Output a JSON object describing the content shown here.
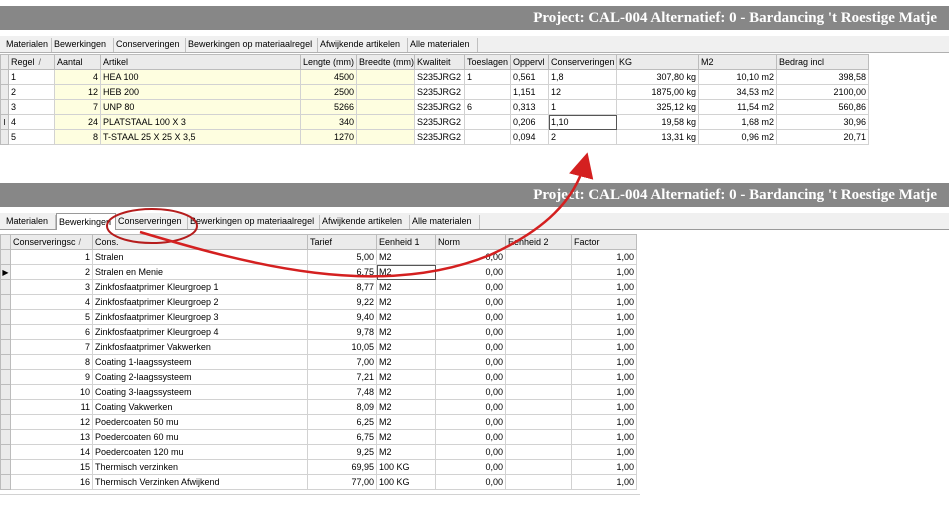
{
  "top": {
    "title": "Project: CAL-004 Alternatief: 0 - Bardancing 't Roestige Matje",
    "tabs": [
      "Materialen",
      "Bewerkingen",
      "Conserveringen",
      "Bewerkingen op materiaalregel",
      "Afwijkende artikelen",
      "Alle materialen"
    ],
    "active_tab": 0,
    "columns": [
      "Regel",
      "Aantal",
      "Artikel",
      "Lengte (mm)",
      "Breedte (mm)",
      "Kwaliteit",
      "Toeslagen",
      "Oppervl",
      "Conserveringen",
      "KG",
      "M2",
      "Bedrag incl"
    ],
    "sort_indicator": "/",
    "row_indicator_current": "I",
    "rows": [
      [
        "1",
        "4",
        "HEA  100",
        "4500",
        "",
        "S235JRG2",
        "1",
        "0,561",
        "1,8",
        "307,80 kg",
        "10,10 m2",
        "398,58"
      ],
      [
        "2",
        "12",
        "HEB  200",
        "2500",
        "",
        "S235JRG2",
        "",
        "1,151",
        "12",
        "1875,00 kg",
        "34,53 m2",
        "2100,00"
      ],
      [
        "3",
        "7",
        "UNP  80",
        "5266",
        "",
        "S235JRG2",
        "6",
        "0,313",
        "1",
        "325,12 kg",
        "11,54 m2",
        "560,86"
      ],
      [
        "4",
        "24",
        "PLATSTAAL 100 X 3",
        "340",
        "",
        "S235JRG2",
        "",
        "0,206",
        "1,10",
        "19,58 kg",
        "1,68 m2",
        "30,96"
      ],
      [
        "5",
        "8",
        "T-STAAL 25 X 25 X 3,5",
        "1270",
        "",
        "S235JRG2",
        "",
        "0,094",
        "2",
        "13,31 kg",
        "0,96 m2",
        "20,71"
      ]
    ]
  },
  "bottom": {
    "title": "Project: CAL-004 Alternatief: 0 - Bardancing 't Roestige Matje",
    "tabs": [
      "Materialen",
      "Bewerkingen",
      "Conserveringen",
      "Bewerkingen op materiaalregel",
      "Afwijkende artikelen",
      "Alle materialen"
    ],
    "active_tab": 2,
    "columns": [
      "Conserveringsc",
      "Cons.",
      "Tarief",
      "Eenheid 1",
      "Norm",
      "Eenheid 2",
      "Factor"
    ],
    "sort_indicator": "/",
    "row_indicator_current": "▶",
    "rows": [
      [
        "1",
        "Stralen",
        "5,00",
        "M2",
        "0,00",
        "",
        "1,00"
      ],
      [
        "2",
        "Stralen en Menie",
        "6,75",
        "M2",
        "0,00",
        "",
        "1,00"
      ],
      [
        "3",
        "Zinkfosfaatprimer Kleurgroep 1",
        "8,77",
        "M2",
        "0,00",
        "",
        "1,00"
      ],
      [
        "4",
        "Zinkfosfaatprimer Kleurgroep 2",
        "9,22",
        "M2",
        "0,00",
        "",
        "1,00"
      ],
      [
        "5",
        "Zinkfosfaatprimer Kleurgroep 3",
        "9,40",
        "M2",
        "0,00",
        "",
        "1,00"
      ],
      [
        "6",
        "Zinkfosfaatprimer Kleurgroep 4",
        "9,78",
        "M2",
        "0,00",
        "",
        "1,00"
      ],
      [
        "7",
        "Zinkfosfaatprimer Vakwerken",
        "10,05",
        "M2",
        "0,00",
        "",
        "1,00"
      ],
      [
        "8",
        "Coating 1-laagssysteem",
        "7,00",
        "M2",
        "0,00",
        "",
        "1,00"
      ],
      [
        "9",
        "Coating 2-laagssysteem",
        "7,21",
        "M2",
        "0,00",
        "",
        "1,00"
      ],
      [
        "10",
        "Coating 3-laagssysteem",
        "7,48",
        "M2",
        "0,00",
        "",
        "1,00"
      ],
      [
        "11",
        "Coating Vakwerken",
        "8,09",
        "M2",
        "0,00",
        "",
        "1,00"
      ],
      [
        "12",
        "Poedercoaten 50 mu",
        "6,25",
        "M2",
        "0,00",
        "",
        "1,00"
      ],
      [
        "13",
        "Poedercoaten 60 mu",
        "6,75",
        "M2",
        "0,00",
        "",
        "1,00"
      ],
      [
        "14",
        "Poedercoaten 120 mu",
        "9,25",
        "M2",
        "0,00",
        "",
        "1,00"
      ],
      [
        "15",
        "Thermisch verzinken",
        "69,95",
        "100 KG",
        "0,00",
        "",
        "1,00"
      ],
      [
        "16",
        "Thermisch Verzinken Afwijkend",
        "77,00",
        "100 KG",
        "0,00",
        "",
        "1,00"
      ]
    ]
  },
  "colors": {
    "title_bg": "#878787",
    "annotation": "#d42020",
    "highlight_cells": "#fefee0"
  }
}
